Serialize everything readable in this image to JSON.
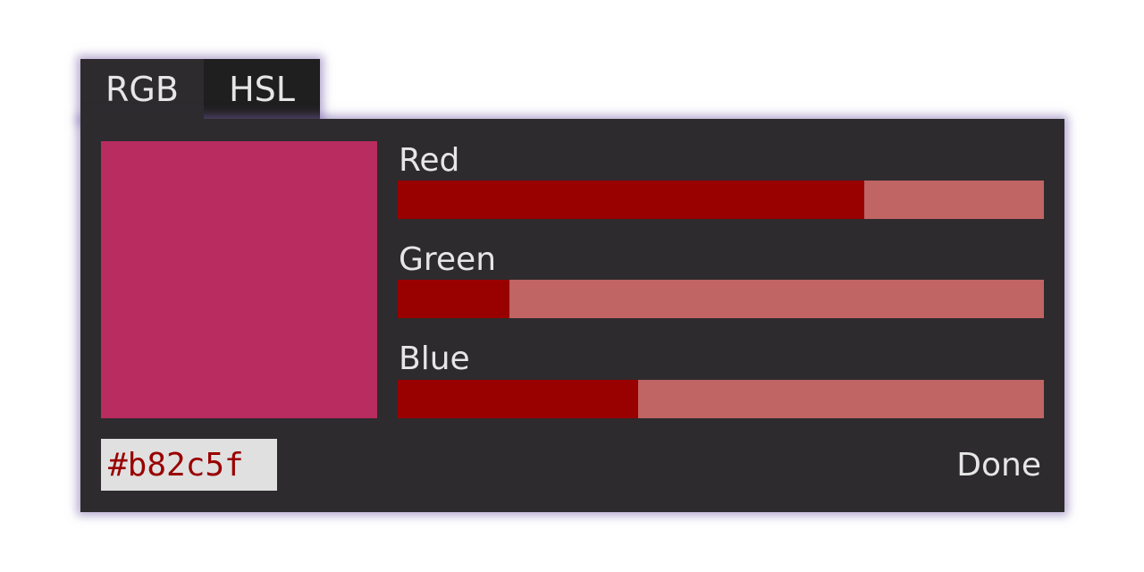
{
  "tabs": [
    {
      "label": "RGB",
      "active": true
    },
    {
      "label": "HSL",
      "active": false
    }
  ],
  "color": {
    "hex": "#b82c5f",
    "swatch_color": "#b82c5f"
  },
  "channels": [
    {
      "label": "Red",
      "value": 184,
      "max": 255
    },
    {
      "label": "Green",
      "value": 44,
      "max": 255
    },
    {
      "label": "Blue",
      "value": 95,
      "max": 255
    }
  ],
  "slider_colors": {
    "fill": "#990000",
    "track": "#c06464"
  },
  "done_label": "Done"
}
